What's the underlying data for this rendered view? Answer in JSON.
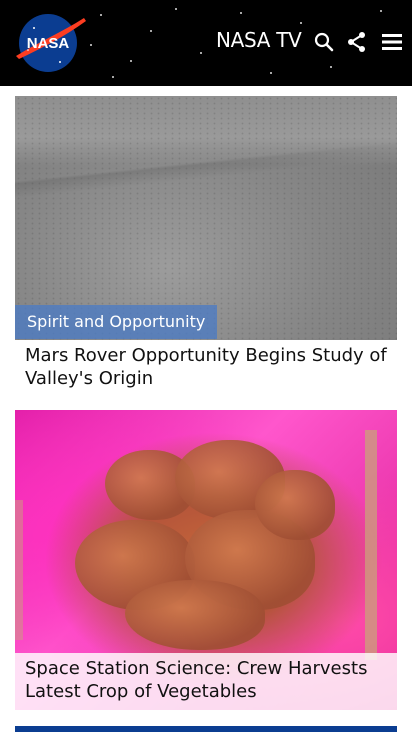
{
  "header": {
    "logo_text": "NASA",
    "title": "NASA TV",
    "icons": [
      "search-icon",
      "share-icon",
      "menu-icon"
    ]
  },
  "feed": {
    "articles": [
      {
        "category": "Spirit and Opportunity",
        "title": "Mars Rover Opportunity Begins Study of Valley's Origin"
      },
      {
        "title": "Space Station Science: Crew Harvests Latest Crop of Vegetables"
      }
    ]
  },
  "colors": {
    "header_bg": "#000000",
    "nasa_blue": "#0b3d91",
    "nasa_red": "#fc3d21",
    "tag_bg": "#4b7bc4"
  }
}
